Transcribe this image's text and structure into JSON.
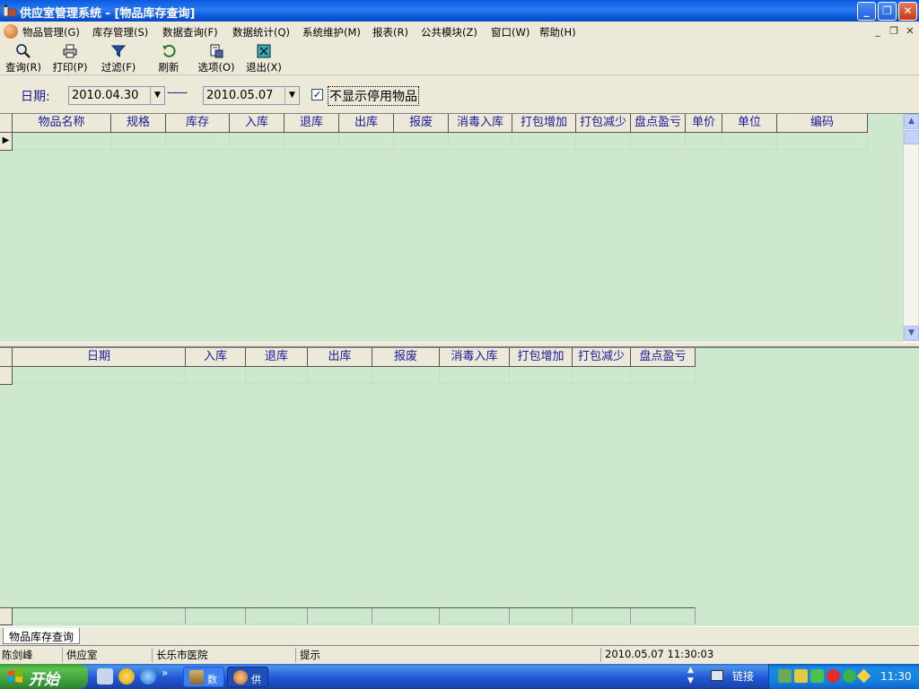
{
  "window": {
    "title": "供应室管理系统 - [物品库存查询]",
    "minimize_label": "_",
    "restore_label": "❐",
    "close_label": "✕"
  },
  "menu": {
    "items": [
      {
        "label": "物品管理(G)"
      },
      {
        "label": "库存管理(S)"
      },
      {
        "label": "数据查询(F)"
      },
      {
        "label": "数据统计(Q)"
      },
      {
        "label": "系统维护(M)"
      },
      {
        "label": "报表(R)"
      },
      {
        "label": "公共模块(Z)"
      },
      {
        "label": "窗口(W)"
      },
      {
        "label": "帮助(H)"
      }
    ],
    "mdi_minimize": "_",
    "mdi_restore": "❐",
    "mdi_close": "✕"
  },
  "toolbar": {
    "query": "查询(R)",
    "print": "打印(P)",
    "filter": "过滤(F)",
    "refresh": "刷新",
    "options": "选项(O)",
    "exit": "退出(X)"
  },
  "filter": {
    "date_label": "日期:",
    "start_date": "2010.04.30",
    "separator": "------",
    "end_date": "2010.05.07",
    "hide_disabled_checked": true,
    "check_mark": "✓",
    "hide_disabled_label": "不显示停用物品",
    "dropdown_arrow": "▼"
  },
  "top_grid": {
    "columns": [
      "物品名称",
      "规格",
      "库存",
      "入库",
      "退库",
      "出库",
      "报废",
      "消毒入库",
      "打包增加",
      "打包减少",
      "盘点盈亏",
      "单价",
      "单位",
      "编码"
    ],
    "rows": [
      [
        "",
        "",
        "",
        "",
        "",
        "",
        "",
        "",
        "",
        "",
        "",
        "",
        "",
        ""
      ]
    ],
    "row_pointer": "▶"
  },
  "bottom_grid": {
    "columns": [
      "日期",
      "入库",
      "退库",
      "出库",
      "报废",
      "消毒入库",
      "打包增加",
      "打包减少",
      "盘点盈亏"
    ],
    "rows": [
      [
        "",
        "",
        "",
        "",
        "",
        "",
        "",
        "",
        ""
      ]
    ]
  },
  "scrollbar": {
    "up": "▲",
    "down": "▼"
  },
  "tabs": [
    {
      "label": "物品库存查询",
      "active": true
    }
  ],
  "status": {
    "user": "陈剑峰",
    "department": "供应室",
    "hospital": "长乐市医院",
    "hint": "提示",
    "datetime": "2010.05.07 11:30:03"
  },
  "taskbar": {
    "start_label": "开始",
    "more": "»",
    "task1_label": "数",
    "task2_label": "供",
    "links_label": "链接",
    "clock": "11:30"
  },
  "colors": {
    "grid_background": "#cde8cd",
    "header_text": "#1a1a9a",
    "titlebar": "#0a5ae0"
  }
}
